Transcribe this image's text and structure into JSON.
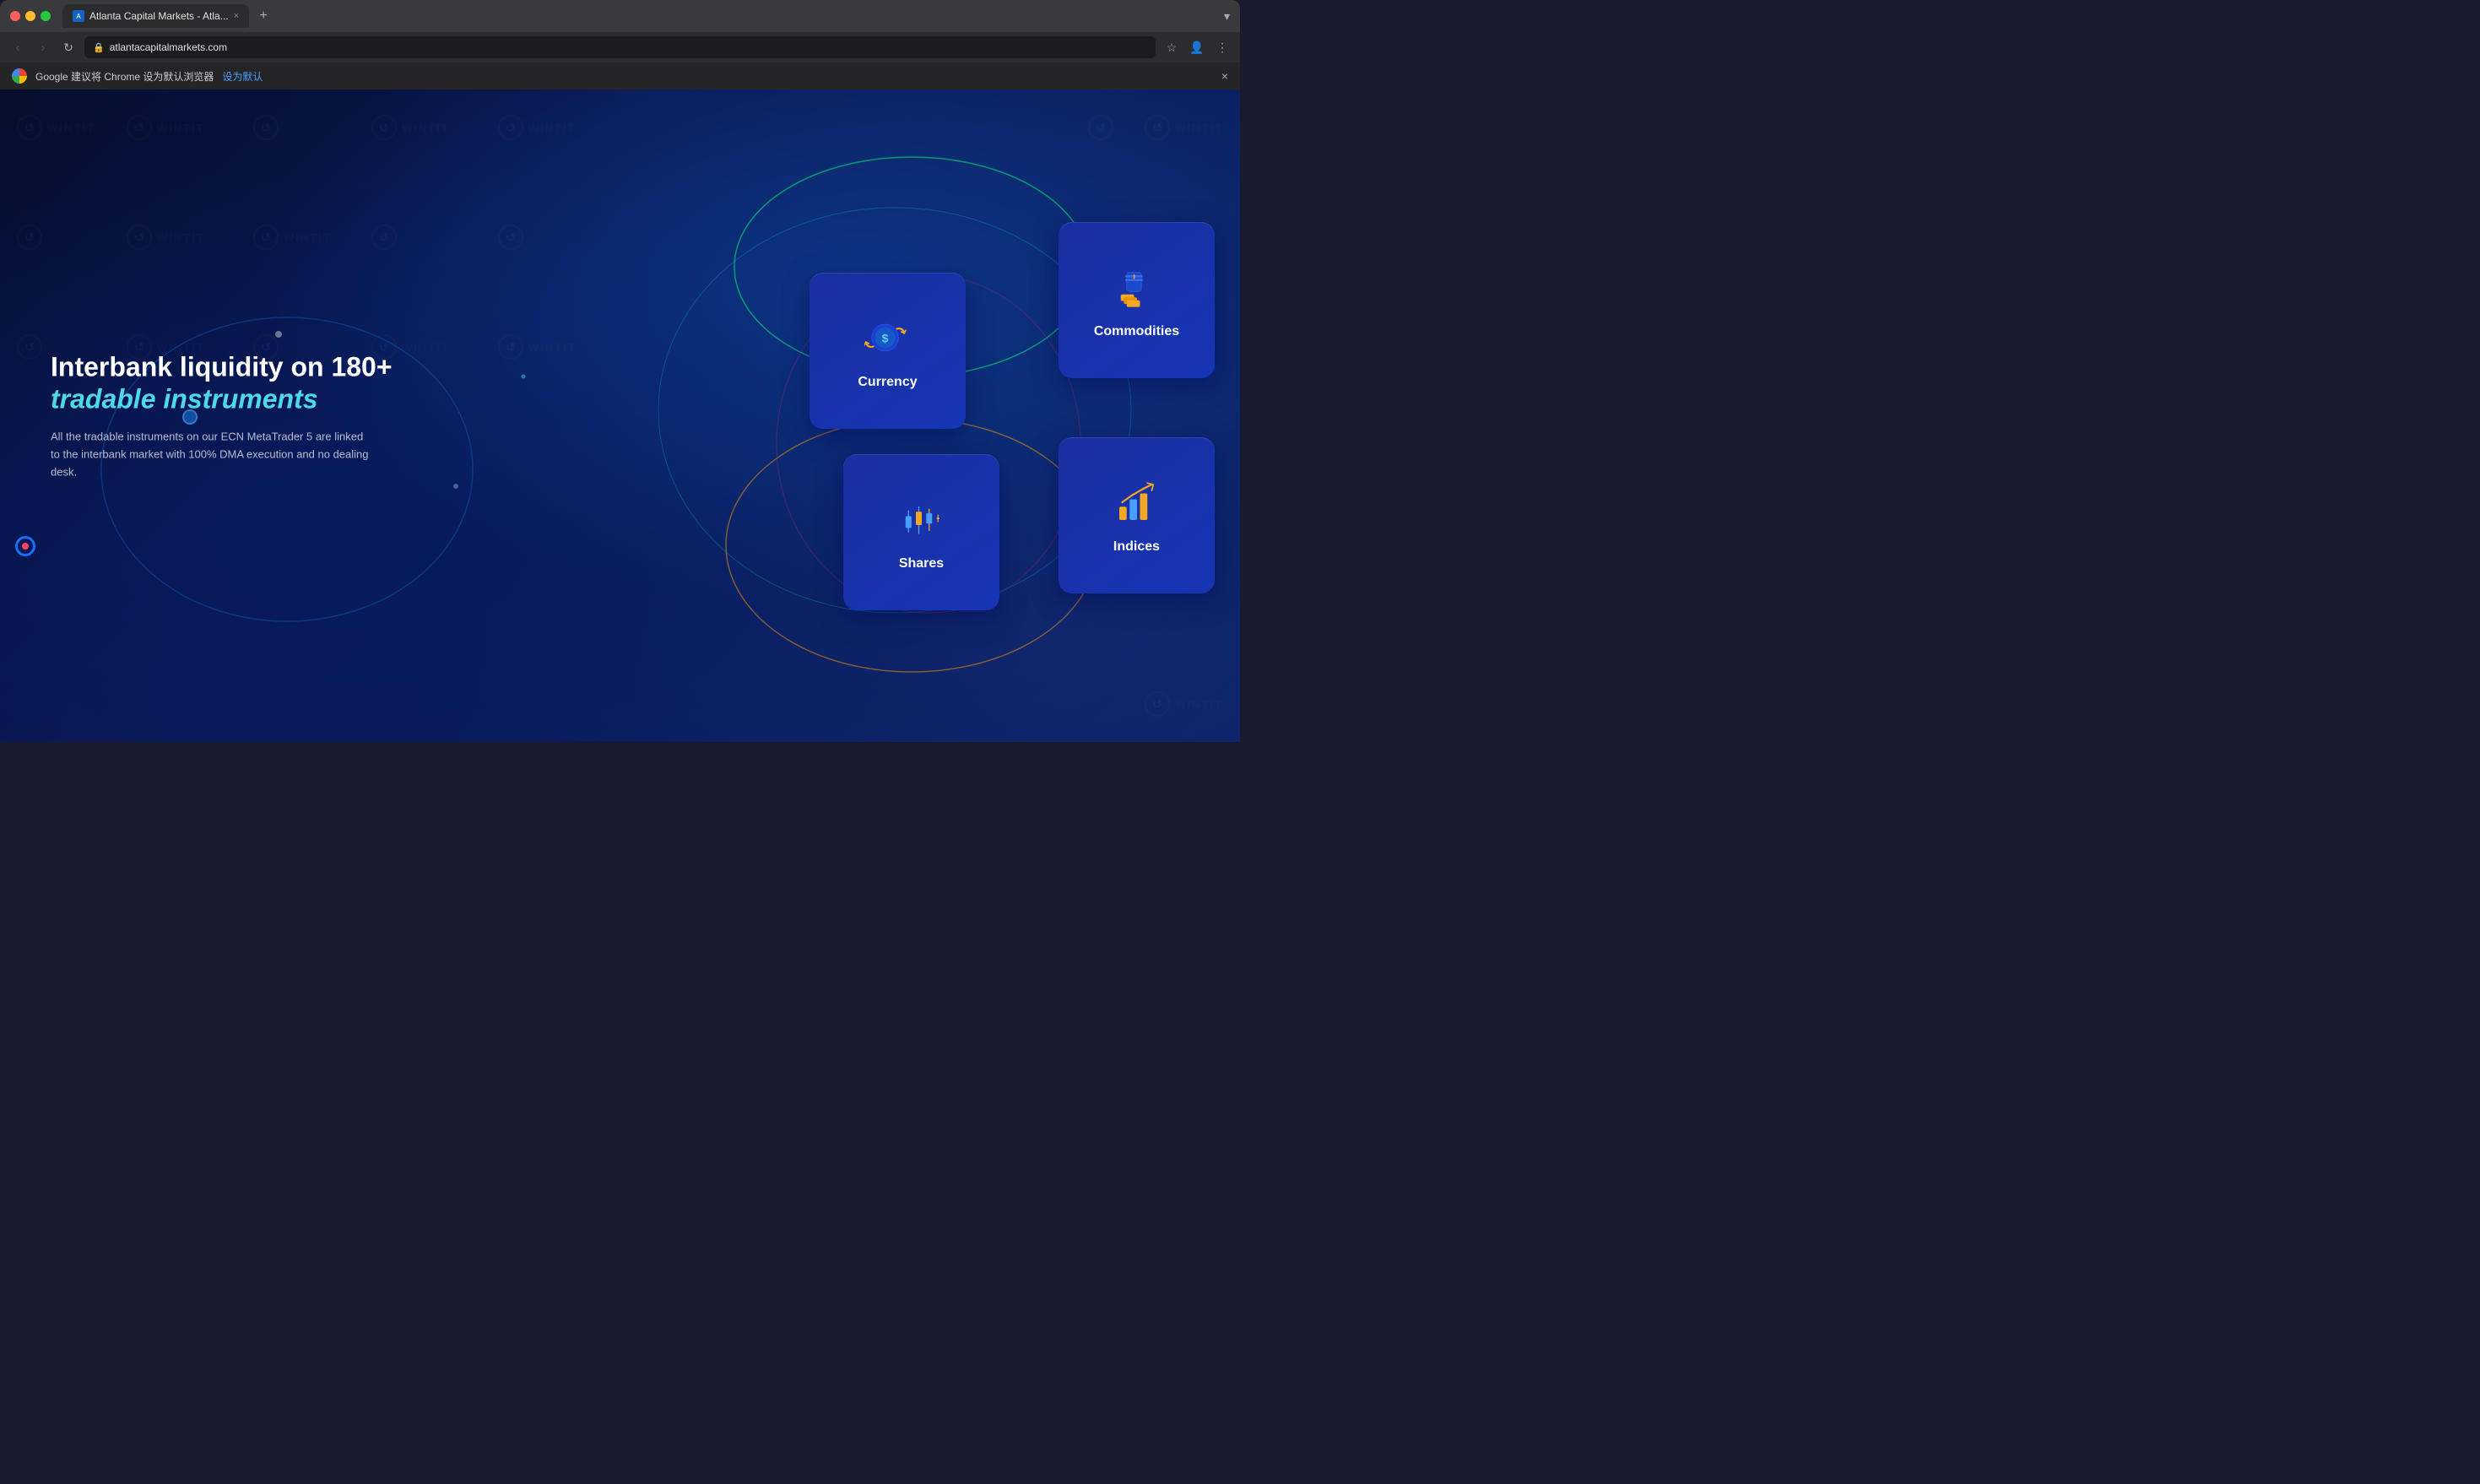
{
  "browser": {
    "traffic_lights": [
      "close",
      "minimize",
      "maximize"
    ],
    "tab": {
      "favicon_text": "A",
      "title": "Atlanta Capital Markets - Atla...",
      "close_label": "×"
    },
    "new_tab_label": "+",
    "chevron_label": "▾",
    "nav": {
      "back_label": "‹",
      "forward_label": "›",
      "refresh_label": "↻"
    },
    "address": "atlantacapitalmarkets.com",
    "bookmark_label": "☆",
    "profile_label": "👤",
    "menu_label": "⋮"
  },
  "notification": {
    "message": "Google 建议将 Chrome 设为默认浏览器",
    "link_text": "设为默认",
    "close_label": "×"
  },
  "content": {
    "headline_part1": "Interbank liquidity on 180+",
    "headline_part2": "tradable instruments",
    "description": "All the tradable instruments on our ECN MetaTrader 5 are linked to the interbank market with 100% DMA execution and no dealing desk.",
    "cards": [
      {
        "id": "currency",
        "label": "Currency",
        "icon": "currency"
      },
      {
        "id": "commodities",
        "label": "Commodities",
        "icon": "commodities"
      },
      {
        "id": "shares",
        "label": "Shares",
        "icon": "shares"
      },
      {
        "id": "indices",
        "label": "Indices",
        "icon": "indices"
      }
    ]
  },
  "colors": {
    "accent_cyan": "#4dd9e8",
    "card_bg": "#1a2fa0",
    "orange": "#f5a623",
    "blue_bright": "#4a7fff"
  }
}
